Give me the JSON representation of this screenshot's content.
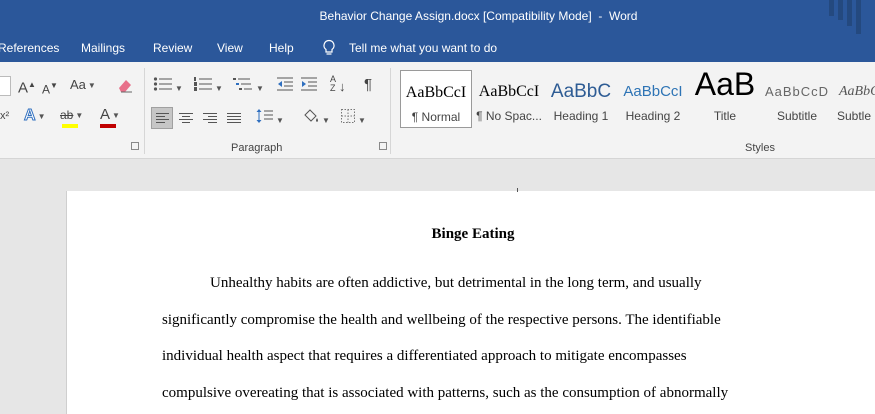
{
  "window": {
    "title": "Behavior Change Assign.docx [Compatibility Mode]  -  Word"
  },
  "tabs": [
    "References",
    "Mailings",
    "Review",
    "View",
    "Help"
  ],
  "tell_me": "Tell me what you want to do",
  "ribbon": {
    "paragraph_label": "Paragraph",
    "styles_label": "Styles",
    "case_label": "Aa",
    "font_size_up": "A",
    "font_size_down": "A",
    "font_color_label": "A",
    "text_effects_label": "A",
    "pilcrow": "¶",
    "superscript_hint": "x²",
    "sort_label": "A Z",
    "highlight_label": "ab",
    "colors": {
      "highlight": "#ffff00",
      "font": "#c00000",
      "effects": "#2f6fbf"
    }
  },
  "styles": [
    {
      "sample": "AaBbCcI",
      "name": "¶ Normal",
      "selected": true
    },
    {
      "sample": "AaBbCcI",
      "name": "¶ No Spac...",
      "selected": false
    },
    {
      "sample": "AaBbC",
      "name": "Heading 1",
      "selected": false
    },
    {
      "sample": "AaBbCcI",
      "name": "Heading 2",
      "selected": false
    },
    {
      "sample": "AaB",
      "name": "Title",
      "selected": false
    },
    {
      "sample": "AaBbCcD",
      "name": "Subtitle",
      "selected": false
    },
    {
      "sample": "AaBbCcD",
      "name": "Subtle E",
      "selected": false
    }
  ],
  "document": {
    "title": "Binge Eating",
    "lines": [
      "Unhealthy habits are often addictive, but detrimental in the long term, and usually",
      "significantly compromise the health and wellbeing of the respective persons. The identifiable",
      "individual health aspect that requires a differentiated approach to mitigate encompasses",
      "compulsive overeating that is associated with patterns, such as the consumption of abnormally"
    ]
  }
}
